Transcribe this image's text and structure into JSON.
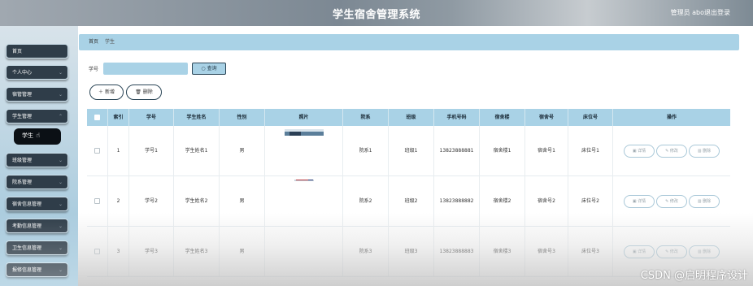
{
  "header": {
    "title": "学生宿舍管理系统",
    "admin_label": "管理员 abo",
    "logout_label": "退出登录"
  },
  "sidebar": {
    "items": [
      {
        "label": "首页",
        "has_chevron": false
      },
      {
        "label": "个人中心",
        "has_chevron": true
      },
      {
        "label": "宿管管理",
        "has_chevron": true
      },
      {
        "label": "学生管理",
        "has_chevron": true
      },
      {
        "label": "班级管理",
        "has_chevron": true
      },
      {
        "label": "院系管理",
        "has_chevron": true
      },
      {
        "label": "宿舍信息管理",
        "has_chevron": true
      },
      {
        "label": "考勤信息管理",
        "has_chevron": true
      },
      {
        "label": "卫生信息管理",
        "has_chevron": true
      },
      {
        "label": "报修信息管理",
        "has_chevron": true
      }
    ],
    "active_submenu": "学生"
  },
  "breadcrumb": {
    "home": "首页",
    "current": "学生"
  },
  "search": {
    "label": "学号",
    "value": "",
    "placeholder": "",
    "button_label": "查询",
    "search_icon": "search-icon"
  },
  "actions": {
    "add_label": "新增",
    "delete_label": "删除"
  },
  "table": {
    "columns": [
      "",
      "索引",
      "学号",
      "学生姓名",
      "性别",
      "照片",
      "院系",
      "班级",
      "手机号码",
      "宿舍楼",
      "宿舍号",
      "床位号",
      "操作"
    ],
    "row_actions": {
      "detail": "详情",
      "edit": "修改",
      "delete": "删除"
    },
    "rows": [
      {
        "index": "1",
        "student_id": "学号1",
        "name": "学生姓名1",
        "gender": "男",
        "dept": "院系1",
        "class": "班级1",
        "phone": "13823888881",
        "building": "宿舍楼1",
        "room": "宿舍号1",
        "bed": "床位号1"
      },
      {
        "index": "2",
        "student_id": "学号2",
        "name": "学生姓名2",
        "gender": "男",
        "dept": "院系2",
        "class": "班级2",
        "phone": "13823888882",
        "building": "宿舍楼2",
        "room": "宿舍号2",
        "bed": "床位号2"
      },
      {
        "index": "3",
        "student_id": "学号3",
        "name": "学生姓名3",
        "gender": "男",
        "dept": "院系3",
        "class": "班级3",
        "phone": "13823888883",
        "building": "宿舍楼3",
        "room": "宿舍号3",
        "bed": "床位号3"
      }
    ]
  },
  "watermark": "CSDN @启明程序设计",
  "colors": {
    "accent": "#a9d2e6",
    "menu_bg": "#2f3d49",
    "submenu_bg": "#0b1015"
  }
}
